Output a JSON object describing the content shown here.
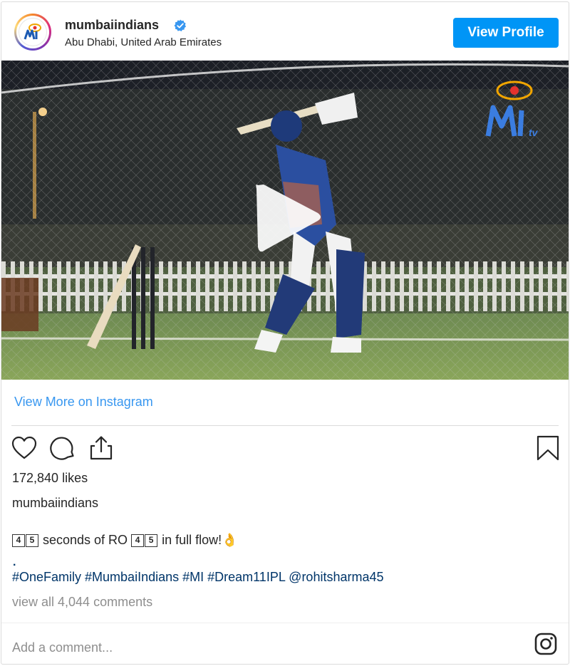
{
  "header": {
    "username": "mumbaiindians",
    "location": "Abu Dhabi, United Arab Emirates",
    "verified_icon": "verified-badge-icon",
    "view_profile_label": "View Profile",
    "accent_color": "#0095f6"
  },
  "media": {
    "type": "video",
    "watermark": "MI tv",
    "play_icon": "play-icon"
  },
  "links": {
    "view_more": "View More on Instagram"
  },
  "actions": {
    "like_icon": "heart-icon",
    "comment_icon": "comment-icon",
    "share_icon": "share-icon",
    "save_icon": "bookmark-icon"
  },
  "post": {
    "likes": "172,840 likes",
    "caption_user": "mumbaiindians",
    "caption_keycap_a": "4",
    "caption_keycap_b": "5",
    "caption_text_1": " seconds of RO ",
    "caption_text_2": " in full flow!",
    "caption_emoji": "👌",
    "dot": ".",
    "hashtags": "#OneFamily #MumbaiIndians #MI #Dream11IPL @rohitsharma45",
    "view_all_comments": "view all 4,044 comments"
  },
  "comment": {
    "placeholder": "Add a comment...",
    "instagram_icon": "instagram-icon"
  }
}
